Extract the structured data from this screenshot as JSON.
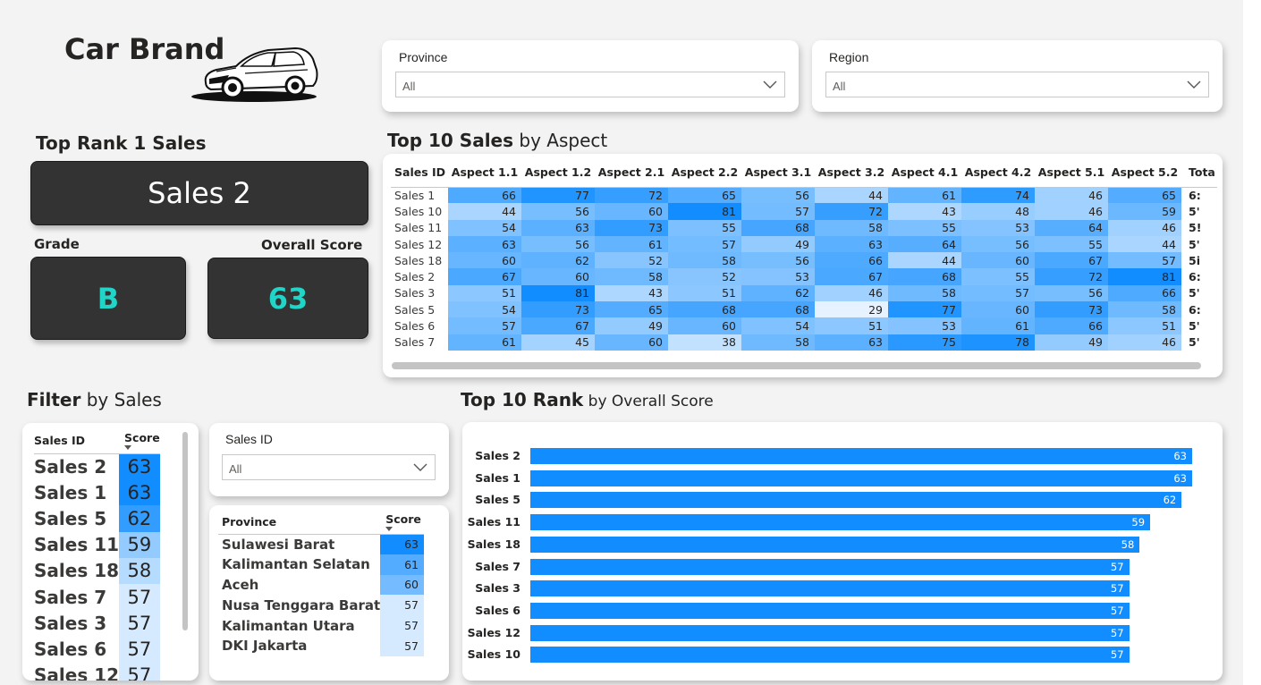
{
  "header": {
    "title": "Car Brand",
    "logo_icon": "car-icon"
  },
  "slicers": {
    "province": {
      "label": "Province",
      "value": "All"
    },
    "region": {
      "label": "Region",
      "value": "All"
    },
    "sales_id": {
      "label": "Sales ID",
      "value": "All"
    }
  },
  "top_rank": {
    "title": "Top Rank 1 Sales",
    "name": "Sales 2",
    "grade_label": "Grade",
    "grade": "B",
    "score_label": "Overall Score",
    "score": "63",
    "accent_color": "#20d5c7"
  },
  "aspect_matrix": {
    "title_bold": "Top 10 Sales",
    "title_rest": " by Aspect",
    "columns": [
      "Sales ID",
      "Aspect 1.1",
      "Aspect 1.2",
      "Aspect 2.1",
      "Aspect 2.2",
      "Aspect 3.1",
      "Aspect 3.2",
      "Aspect 4.1",
      "Aspect 4.2",
      "Aspect 5.1",
      "Aspect 5.2",
      "Tota"
    ],
    "rows": [
      {
        "id": "Sales 1",
        "values": [
          66,
          77,
          72,
          65,
          56,
          44,
          61,
          74,
          46,
          65
        ],
        "total": "6:"
      },
      {
        "id": "Sales 10",
        "values": [
          44,
          56,
          60,
          81,
          57,
          72,
          43,
          48,
          46,
          59
        ],
        "total": "5'"
      },
      {
        "id": "Sales 11",
        "values": [
          54,
          63,
          73,
          55,
          68,
          58,
          55,
          53,
          64,
          46
        ],
        "total": "5!"
      },
      {
        "id": "Sales 12",
        "values": [
          63,
          56,
          61,
          57,
          49,
          63,
          64,
          56,
          55,
          44
        ],
        "total": "5'"
      },
      {
        "id": "Sales 18",
        "values": [
          60,
          62,
          52,
          58,
          56,
          66,
          44,
          60,
          67,
          57
        ],
        "total": "5i"
      },
      {
        "id": "Sales 2",
        "values": [
          67,
          60,
          58,
          52,
          53,
          67,
          68,
          55,
          72,
          81
        ],
        "total": "6:"
      },
      {
        "id": "Sales 3",
        "values": [
          51,
          81,
          43,
          51,
          62,
          46,
          58,
          57,
          56,
          66
        ],
        "total": "5'"
      },
      {
        "id": "Sales 5",
        "values": [
          54,
          73,
          65,
          68,
          68,
          29,
          77,
          60,
          73,
          58
        ],
        "total": "6:"
      },
      {
        "id": "Sales 6",
        "values": [
          57,
          67,
          49,
          60,
          54,
          51,
          53,
          61,
          66,
          51
        ],
        "total": "5'"
      },
      {
        "id": "Sales 7",
        "values": [
          61,
          45,
          60,
          38,
          58,
          63,
          75,
          78,
          49,
          46
        ],
        "total": "5'"
      }
    ]
  },
  "filter_by_sales": {
    "title_bold": "Filter",
    "title_rest": " by Sales",
    "columns": [
      "Sales ID",
      "Score"
    ],
    "rows": [
      {
        "name": "Sales 2",
        "score": 63
      },
      {
        "name": "Sales 1",
        "score": 63
      },
      {
        "name": "Sales 5",
        "score": 62
      },
      {
        "name": "Sales 11",
        "score": 59
      },
      {
        "name": "Sales 18",
        "score": 58
      },
      {
        "name": "Sales 7",
        "score": 57
      },
      {
        "name": "Sales 3",
        "score": 57
      },
      {
        "name": "Sales 6",
        "score": 57
      },
      {
        "name": "Sales 12",
        "score": 57
      }
    ]
  },
  "province_table": {
    "columns": [
      "Province",
      "Score"
    ],
    "rows": [
      {
        "name": "Sulawesi Barat",
        "score": 63
      },
      {
        "name": "Kalimantan Selatan",
        "score": 61
      },
      {
        "name": "Aceh",
        "score": 60
      },
      {
        "name": "Nusa Tenggara Barat",
        "score": 57
      },
      {
        "name": "Kalimantan Utara",
        "score": 57
      },
      {
        "name": "DKI Jakarta",
        "score": 57
      }
    ]
  },
  "chart_data": {
    "type": "bar",
    "orientation": "horizontal",
    "title": "Top 10 Rank by Overall Score",
    "title_bold": "Top 10 Rank",
    "title_rest": " by Overall Score",
    "categories": [
      "Sales 2",
      "Sales 1",
      "Sales 5",
      "Sales 11",
      "Sales 18",
      "Sales 7",
      "Sales 3",
      "Sales 6",
      "Sales 12",
      "Sales 10"
    ],
    "values": [
      63,
      63,
      62,
      59,
      58,
      57,
      57,
      57,
      57,
      57
    ],
    "xlabel": "",
    "ylabel": "",
    "xlim": [
      0,
      63
    ],
    "data_labels": true,
    "grid": false,
    "bar_color": "#118dff"
  },
  "colors": {
    "accent": "#118dff",
    "kpi_bg": "#333333",
    "kpi_text": "#ffffff",
    "grade_text": "#20d5c7"
  }
}
